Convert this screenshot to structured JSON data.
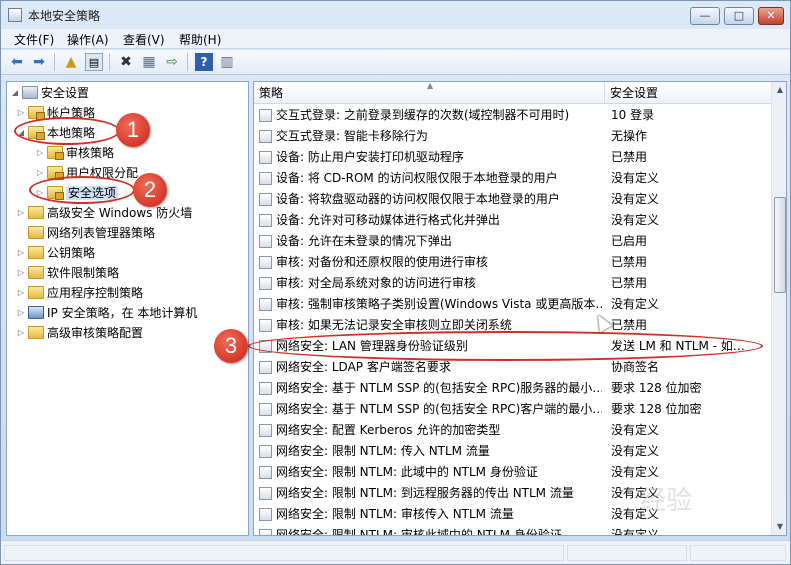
{
  "window": {
    "title": "本地安全策略",
    "minimize_glyph": "—",
    "maximize_glyph": "□",
    "close_glyph": "✕"
  },
  "menu": [
    "文件(F)",
    "操作(A)",
    "查看(V)",
    "帮助(H)"
  ],
  "toolbar_icons": [
    "back-arrow-icon",
    "forward-arrow-icon",
    "up-folder-icon",
    "show-tree-icon",
    "delete-icon",
    "properties-icon",
    "export-icon",
    "help-icon",
    "view-icon"
  ],
  "tree": [
    {
      "label": "安全设置",
      "expander": "◢",
      "icon": "security-settings-icon"
    },
    {
      "label": "帐户策略",
      "expander": "▷",
      "icon": "folder-lock-icon"
    },
    {
      "label": "本地策略",
      "expander": "◢",
      "icon": "folder-lock-icon"
    },
    {
      "label": "审核策略",
      "expander": "▷",
      "icon": "folder-lock-icon"
    },
    {
      "label": "用户权限分配",
      "expander": "▷",
      "icon": "folder-lock-icon"
    },
    {
      "label": "安全选项",
      "expander": "▷",
      "icon": "folder-lock-icon"
    },
    {
      "label": "高级安全 Windows 防火墙",
      "expander": "▷",
      "icon": "folder-icon"
    },
    {
      "label": "网络列表管理器策略",
      "expander": "",
      "icon": "folder-icon"
    },
    {
      "label": "公钥策略",
      "expander": "▷",
      "icon": "folder-icon"
    },
    {
      "label": "软件限制策略",
      "expander": "▷",
      "icon": "folder-icon"
    },
    {
      "label": "应用程序控制策略",
      "expander": "▷",
      "icon": "folder-icon"
    },
    {
      "label": "IP 安全策略，在 本地计算机",
      "expander": "▷",
      "icon": "ip-policy-icon"
    },
    {
      "label": "高级审核策略配置",
      "expander": "▷",
      "icon": "folder-icon"
    }
  ],
  "columns": {
    "policy": "策略",
    "setting": "安全设置",
    "sort_glyph": "▲"
  },
  "rows": [
    {
      "policy": "交互式登录: 之前登录到缓存的次数(域控制器不可用时)",
      "setting": "10 登录"
    },
    {
      "policy": "交互式登录: 智能卡移除行为",
      "setting": "无操作"
    },
    {
      "policy": "设备: 防止用户安装打印机驱动程序",
      "setting": "已禁用"
    },
    {
      "policy": "设备: 将 CD-ROM 的访问权限仅限于本地登录的用户",
      "setting": "没有定义"
    },
    {
      "policy": "设备: 将软盘驱动器的访问权限仅限于本地登录的用户",
      "setting": "没有定义"
    },
    {
      "policy": "设备: 允许对可移动媒体进行格式化并弹出",
      "setting": "没有定义"
    },
    {
      "policy": "设备: 允许在未登录的情况下弹出",
      "setting": "已启用"
    },
    {
      "policy": "审核: 对备份和还原权限的使用进行审核",
      "setting": "已禁用"
    },
    {
      "policy": "审核: 对全局系统对象的访问进行审核",
      "setting": "已禁用"
    },
    {
      "policy": "审核: 强制审核策略子类别设置(Windows Vista 或更高版本…",
      "setting": "没有定义"
    },
    {
      "policy": "审核: 如果无法记录安全审核则立即关闭系统",
      "setting": "已禁用"
    },
    {
      "policy": "网络安全: LAN 管理器身份验证级别",
      "setting": "发送 LM 和 NTLM - 如…"
    },
    {
      "policy": "网络安全: LDAP 客户端签名要求",
      "setting": "协商签名"
    },
    {
      "policy": "网络安全: 基于 NTLM SSP 的(包括安全 RPC)服务器的最小…",
      "setting": "要求 128 位加密"
    },
    {
      "policy": "网络安全: 基于 NTLM SSP 的(包括安全 RPC)客户端的最小…",
      "setting": "要求 128 位加密"
    },
    {
      "policy": "网络安全: 配置 Kerberos 允许的加密类型",
      "setting": "没有定义"
    },
    {
      "policy": "网络安全: 限制 NTLM: 传入 NTLM 流量",
      "setting": "没有定义"
    },
    {
      "policy": "网络安全: 限制 NTLM: 此域中的 NTLM 身份验证",
      "setting": "没有定义"
    },
    {
      "policy": "网络安全: 限制 NTLM: 到远程服务器的传出 NTLM 流量",
      "setting": "没有定义"
    },
    {
      "policy": "网络安全: 限制 NTLM: 审核传入 NTLM 流量",
      "setting": "没有定义"
    },
    {
      "policy": "网络安全: 限制 NTLM: 审核此域中的 NTLM 身份验证",
      "setting": "没有定义"
    }
  ],
  "annotations": {
    "badge1": "1",
    "badge2": "2",
    "badge3": "3",
    "accent": "#d12f25"
  },
  "watermark": "经验"
}
